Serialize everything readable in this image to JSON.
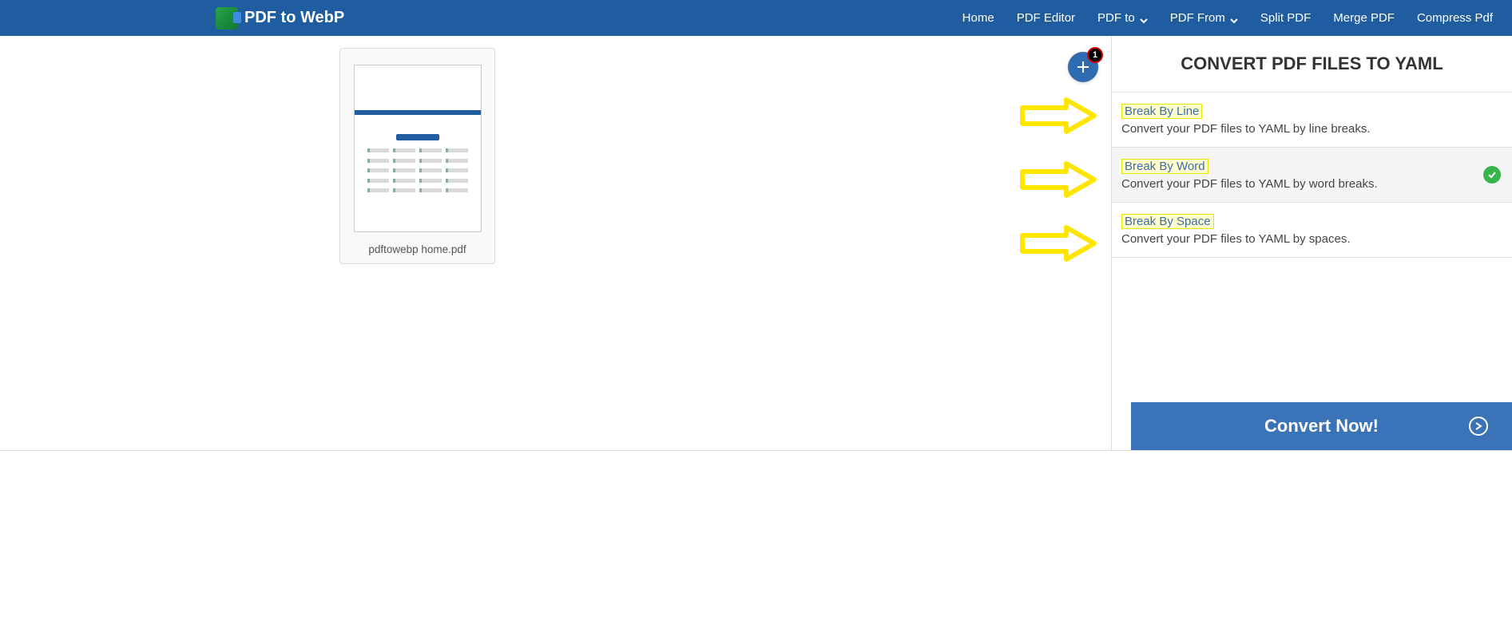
{
  "brand": {
    "name": "PDF to WebP"
  },
  "nav": {
    "home": "Home",
    "editor": "PDF Editor",
    "to": "PDF to",
    "from": "PDF From",
    "split": "Split PDF",
    "merge": "Merge PDF",
    "compress": "Compress Pdf"
  },
  "file": {
    "name": "pdftowebp home.pdf",
    "badge": "1"
  },
  "panel": {
    "title": "CONVERT PDF FILES TO YAML",
    "options": [
      {
        "name": "Break By Line",
        "desc": "Convert your PDF files to YAML by line breaks.",
        "selected": false
      },
      {
        "name": "Break By Word",
        "desc": "Convert your PDF files to YAML by word breaks.",
        "selected": true
      },
      {
        "name": "Break By Space",
        "desc": "Convert your PDF files to YAML by spaces.",
        "selected": false
      }
    ],
    "cta": "Convert Now!"
  }
}
